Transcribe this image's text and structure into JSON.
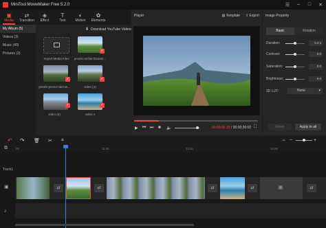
{
  "app": {
    "title": "MiniTool MovieMaker Free 5.2.0"
  },
  "toolbar": [
    {
      "label": "Media",
      "icon": "media-icon"
    },
    {
      "label": "Transition",
      "icon": "transition-icon"
    },
    {
      "label": "Effect",
      "icon": "effect-icon"
    },
    {
      "label": "Text",
      "icon": "text-icon"
    },
    {
      "label": "Motion",
      "icon": "motion-icon"
    },
    {
      "label": "Elements",
      "icon": "elements-icon"
    }
  ],
  "albums": [
    {
      "label": "My Album (5)"
    },
    {
      "label": "Videos (3)"
    },
    {
      "label": "Music (40)"
    },
    {
      "label": "Pictures (2)"
    }
  ],
  "media": {
    "download_label": "Download YouTube Videos",
    "import_label": "Import Media Files",
    "items": [
      {
        "caption": "pexels-archie-binamir..."
      },
      {
        "caption": "pexels-pixmo-narrow..."
      },
      {
        "caption": "video (4)"
      },
      {
        "caption": "video (2)"
      },
      {
        "caption": "video 4"
      }
    ]
  },
  "player": {
    "title": "Player",
    "template_label": "Template",
    "export_label": "Export",
    "current_time": "00:00:00.15",
    "total_time": "/ 00:00:36:02",
    "progress": 0.2
  },
  "property": {
    "title": "Image Property",
    "tabs": [
      "Basic",
      "Rotation"
    ],
    "rows": [
      {
        "label": "Duration:",
        "value": "5.0 s"
      },
      {
        "label": "Contrast:",
        "value": "0.0"
      },
      {
        "label": "Saturation:",
        "value": "0.0"
      },
      {
        "label": "Brightness:",
        "value": "0.0"
      }
    ],
    "lut_label": "3D LUT:",
    "lut_value": "None",
    "reset_label": "Reset",
    "apply_label": "Apply to all"
  },
  "timeline": {
    "ruler_marks": [
      "0s",
      "11.6s",
      "23.2s",
      "34.8s"
    ],
    "track_label": "Track1"
  },
  "colors": {
    "accent": "#e84b3c",
    "bg": "#1e1e1e",
    "panel": "#262626"
  }
}
